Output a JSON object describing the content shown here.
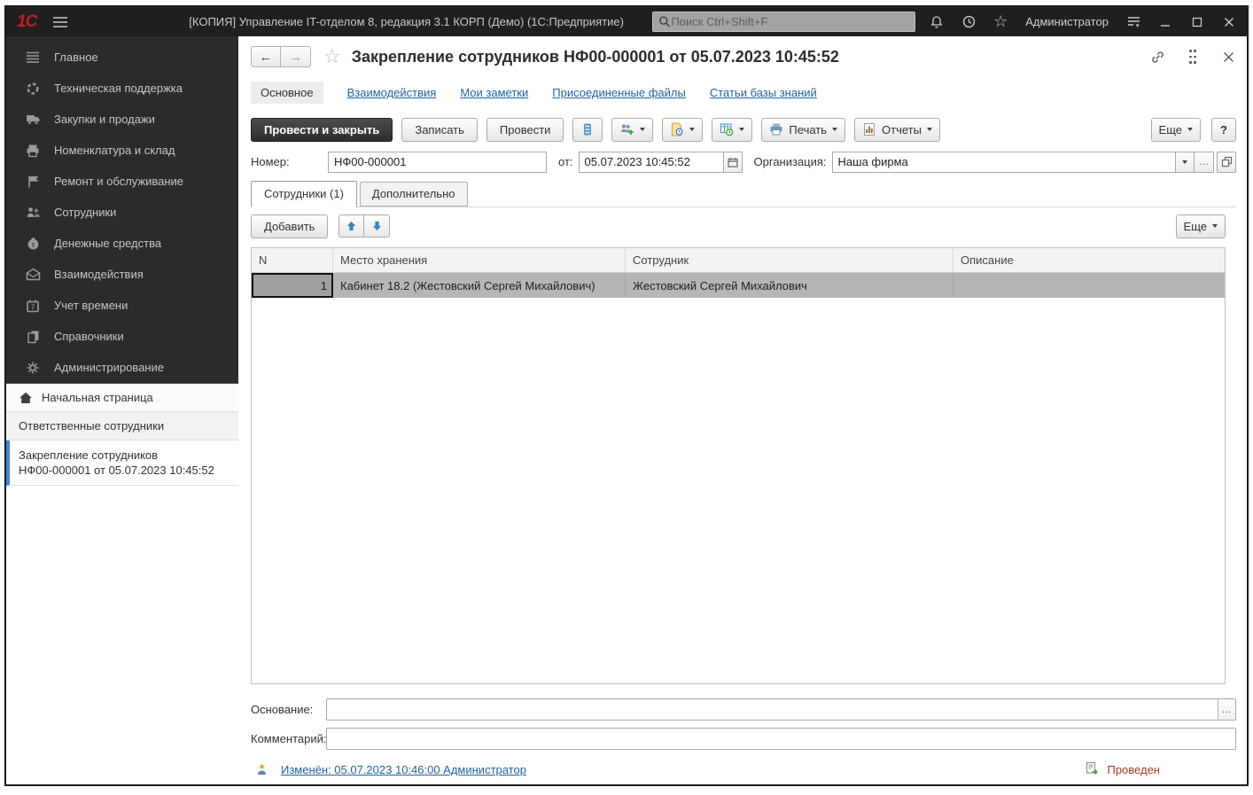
{
  "window": {
    "logo": "1С",
    "title": "[КОПИЯ] Управление IT-отделом 8, редакция 3.1 КОРП (Демо)  (1С:Предприятие)",
    "search_placeholder": "Поиск Ctrl+Shift+F",
    "user": "Администратор"
  },
  "sidebar": {
    "modules": [
      {
        "label": "Главное",
        "icon": "menu-lines-icon"
      },
      {
        "label": "Техническая поддержка",
        "icon": "lifering-icon"
      },
      {
        "label": "Закупки и продажи",
        "icon": "truck-icon"
      },
      {
        "label": "Номенклатура и склад",
        "icon": "printer-box-icon"
      },
      {
        "label": "Ремонт и обслуживание",
        "icon": "flag-icon"
      },
      {
        "label": "Сотрудники",
        "icon": "people-icon"
      },
      {
        "label": "Денежные средства",
        "icon": "money-bag-icon"
      },
      {
        "label": "Взаимодействия",
        "icon": "envelope-icon"
      },
      {
        "label": "Учет времени",
        "icon": "calendar-icon"
      },
      {
        "label": "Справочники",
        "icon": "pages-icon"
      },
      {
        "label": "Администрирование",
        "icon": "gear-icon"
      }
    ],
    "windows": [
      {
        "label": "Начальная страница",
        "icon": "home-icon"
      },
      {
        "label": "Ответственные сотрудники"
      },
      {
        "label_line1": "Закрепление сотрудников",
        "label_line2": "НФ00-000001 от 05.07.2023 10:45:52",
        "active": true
      }
    ]
  },
  "doc": {
    "title": "Закрепление сотрудников НФ00-000001 от 05.07.2023 10:45:52",
    "nav": {
      "active": "Основное",
      "links": [
        "Взаимодействия",
        "Мои заметки",
        "Присоединенные файлы",
        "Статьи базы знаний"
      ]
    },
    "toolbar": {
      "post_close": "Провести и закрыть",
      "save": "Записать",
      "post": "Провести",
      "print": "Печать",
      "reports": "Отчеты",
      "more": "Еще",
      "help": "?"
    },
    "fields": {
      "number_label": "Номер:",
      "number": "НФ00-000001",
      "date_label": "от:",
      "date": "05.07.2023 10:45:52",
      "org_label": "Организация:",
      "org": "Наша фирма"
    },
    "tabs": [
      {
        "label": "Сотрудники (1)"
      },
      {
        "label": "Дополнительно"
      }
    ],
    "grid_toolbar": {
      "add": "Добавить",
      "more": "Еще"
    },
    "table": {
      "headers": [
        "N",
        "Место хранения",
        "Сотрудник",
        "Описание"
      ],
      "rows": [
        [
          "1",
          "Кабинет 18.2 (Жестовский Сергей Михайлович)",
          "Жестовский Сергей Михайлович",
          ""
        ]
      ]
    },
    "footer": {
      "reason_label": "Основание:",
      "reason_value": "",
      "comment_label": "Комментарий:",
      "comment_value": "",
      "modified_link": "Изменён: 05.07.2023 10:46:00 Администратор",
      "posted_status": "Проведен"
    }
  },
  "colors": {
    "titlebar-bg": "#1f1f1f",
    "sidebar-bg": "#2b2b2b",
    "accent-blue": "#3f87d6",
    "link-blue": "#2264a5",
    "selected-row": "#b6b6b6",
    "posted-red": "#a03c1d",
    "logo-red": "#c0201e"
  }
}
